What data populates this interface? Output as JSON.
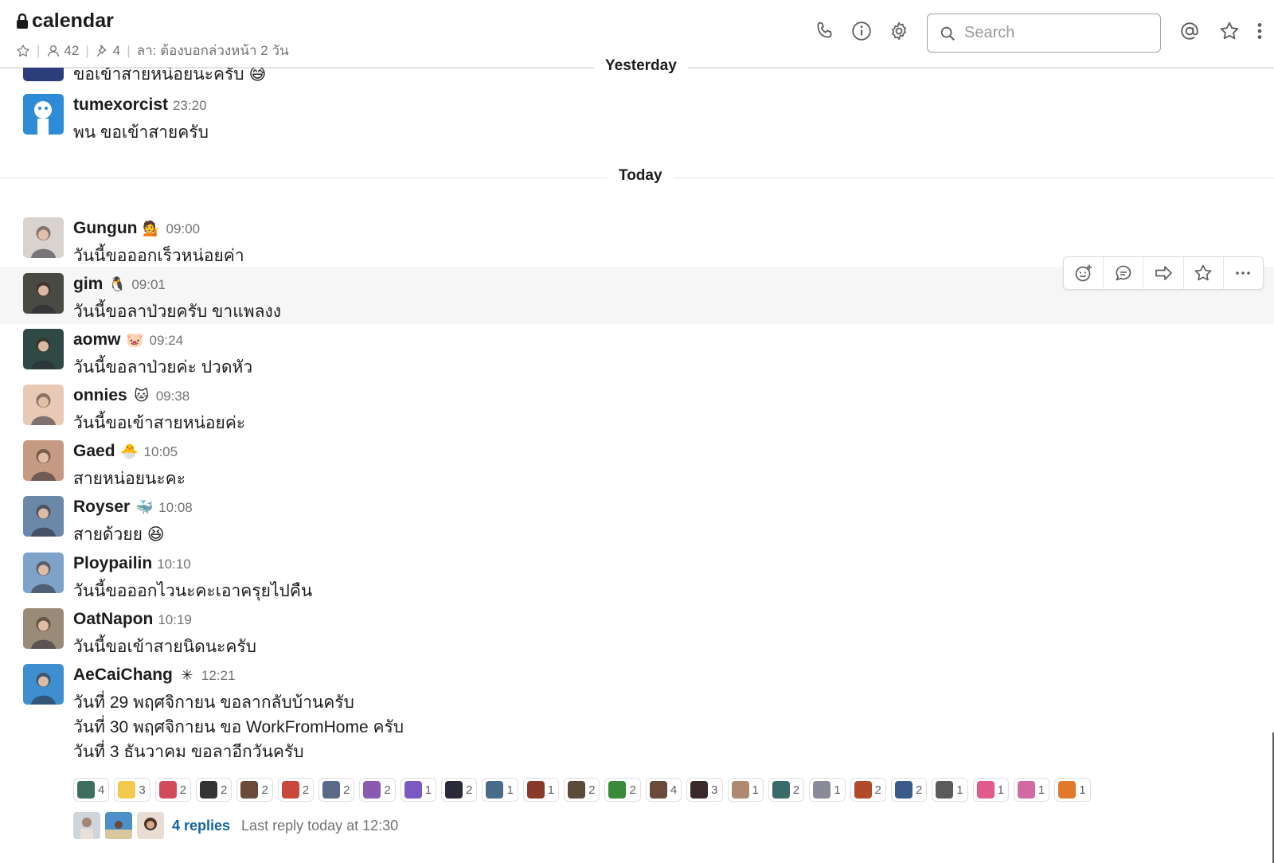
{
  "channel": {
    "name": "calendar",
    "member_count": "42",
    "pinned_count": "4",
    "topic": "ลา: ต้องบอกล่วงหน้า 2 วัน"
  },
  "search": {
    "placeholder": "Search"
  },
  "dividers": {
    "yesterday": "Yesterday",
    "today": "Today"
  },
  "partial_message": {
    "text": "ขอเข้าสายหน่อยนะครับ",
    "emoji": "😅"
  },
  "yesterday_message": {
    "name": "tumexorcist",
    "time": "23:20",
    "text": "พน ขอเข้าสายครับ"
  },
  "messages": [
    {
      "name": "Gungun",
      "status": "💁",
      "time": "09:00",
      "text": "วันนี้ขอออกเร็วหน่อยค่า",
      "avatar_color": "#d9d3cf"
    },
    {
      "name": "gim",
      "status": "🐧",
      "time": "09:01",
      "text": "วันนี้ขอลาป่วยครับ ขาแพลงง",
      "avatar_color": "#4a4a44"
    },
    {
      "name": "aomw",
      "status": "🐷",
      "time": "09:24",
      "text": "วันนี้ขอลาป่วยค่ะ ปวดหัว",
      "avatar_color": "#2f4a45"
    },
    {
      "name": "onnies",
      "status": "🐱",
      "time": "09:38",
      "text": "วันนี้ขอเข้าสายหน่อยค่ะ",
      "avatar_color": "#e8c9b6"
    },
    {
      "name": "Gaed",
      "status": "🐣",
      "time": "10:05",
      "text": "สายหน่อยนะคะ",
      "avatar_color": "#c49a82"
    },
    {
      "name": "Royser",
      "status": "🐳",
      "time": "10:08",
      "text": "สายด้วยย",
      "emoji": "😆",
      "avatar_color": "#6a88a8"
    },
    {
      "name": "Ploypailin",
      "status": "",
      "time": "10:10",
      "text": "วันนี้ขอออกไวนะคะเอาครุยไปคืน",
      "avatar_color": "#7fa2c8"
    },
    {
      "name": "OatNapon",
      "status": "",
      "time": "10:19",
      "text": "วันนี้ขอเข้าสายนิดนะครับ",
      "avatar_color": "#9a8a78"
    },
    {
      "name": "AeCaiChang",
      "status": "✳",
      "time": "12:21",
      "avatar_color": "#3f8fd0",
      "lines": [
        "วันที่ 29 พฤศจิกายน ขอลากลับบ้านครับ",
        "วันที่ 30 พฤศจิกายน ขอ WorkFromHome ครับ",
        "วันที่ 3 ธันวาคม  ขอลาอีกวันครับ"
      ]
    }
  ],
  "reactions": [
    {
      "count": "4",
      "color": "#3d6e5e"
    },
    {
      "count": "3",
      "color": "#f2c94c"
    },
    {
      "count": "2",
      "color": "#d24b5a"
    },
    {
      "count": "2",
      "color": "#333333"
    },
    {
      "count": "2",
      "color": "#6c4a3a"
    },
    {
      "count": "2",
      "color": "#c9473d"
    },
    {
      "count": "2",
      "color": "#5a6a8a"
    },
    {
      "count": "2",
      "color": "#8a5ab0"
    },
    {
      "count": "1",
      "color": "#7a5ac0"
    },
    {
      "count": "2",
      "color": "#2a2a3a"
    },
    {
      "count": "1",
      "color": "#4a6a8a"
    },
    {
      "count": "1",
      "color": "#8a3a2a"
    },
    {
      "count": "2",
      "color": "#5a4a3a"
    },
    {
      "count": "2",
      "color": "#3a8a3a"
    },
    {
      "count": "4",
      "color": "#6a4a3a"
    },
    {
      "count": "3",
      "color": "#3a2a2a"
    },
    {
      "count": "1",
      "color": "#b08a70"
    },
    {
      "count": "2",
      "color": "#3a6a6a"
    },
    {
      "count": "1",
      "color": "#8a8a9a"
    },
    {
      "count": "2",
      "color": "#b04a2a"
    },
    {
      "count": "2",
      "color": "#3a5a8a"
    },
    {
      "count": "1",
      "color": "#5a5a5a"
    },
    {
      "count": "1",
      "color": "#e05a8a"
    },
    {
      "count": "1",
      "color": "#d06aa0"
    },
    {
      "count": "1",
      "color": "#e07a2a"
    }
  ],
  "thread": {
    "replies": "4 replies",
    "last_reply": "Last reply today at 12:30"
  }
}
